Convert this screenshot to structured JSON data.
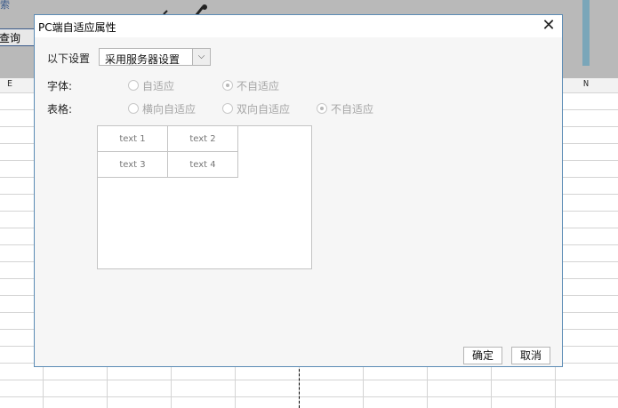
{
  "background": {
    "left_text": "索",
    "query_button": "查询",
    "column_labels": {
      "e": "E",
      "n": "N"
    }
  },
  "dialog": {
    "title": "PC端自适应属性",
    "close_glyph": "✕",
    "setting": {
      "label": "以下设置",
      "selected": "采用服务器设置",
      "arrow_glyph": "⌵"
    },
    "font": {
      "label": "字体:",
      "options": [
        "自适应",
        "不自适应"
      ],
      "selected_index": 1
    },
    "table": {
      "label": "表格:",
      "options": [
        "横向自适应",
        "双向自适应",
        "不自适应"
      ],
      "selected_index": 2
    },
    "preview_cells": [
      "text 1",
      "text 2",
      "text 3",
      "text 4"
    ],
    "ok_label": "确定",
    "cancel_label": "取消"
  }
}
